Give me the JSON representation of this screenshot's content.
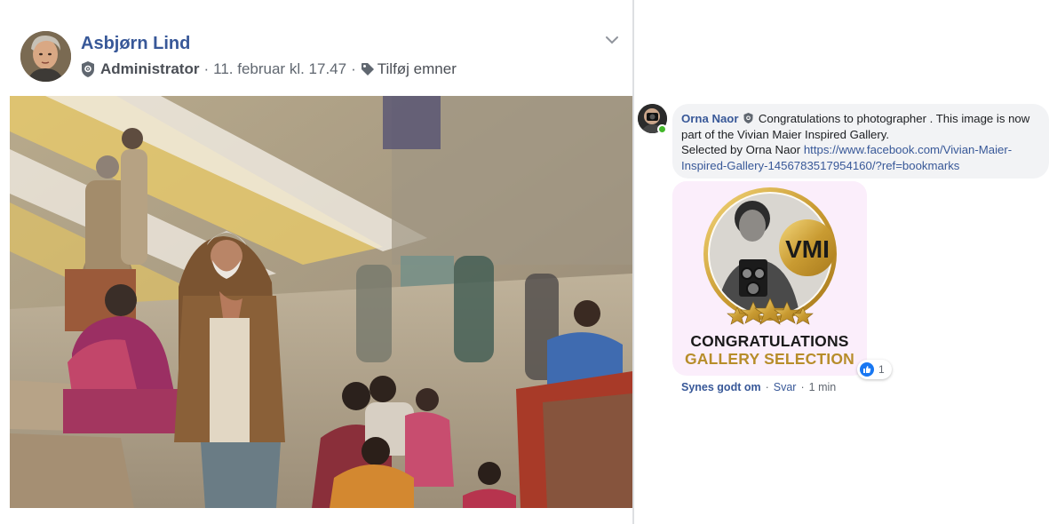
{
  "post": {
    "author": "Asbjørn Lind",
    "role": "Administrator",
    "timestamp": "11. februar kl. 17.47",
    "add_topics": "Tilføj emner",
    "separator": "·",
    "role_icon": "shield-icon",
    "topics_icon": "tag-icon",
    "menu_icon": "chevron-down-icon"
  },
  "comment": {
    "author": "Orna Naor",
    "text_main": "Congratulations to photographer . This image is now part of the Vivian Maier Inspired Gallery.",
    "selected_by": "Selected by Orna Naor",
    "link": "https://www.facebook.com/Vivian-Maier-Inspired-Gallery-1456783517954160/?ref=bookmarks",
    "sticker": {
      "badge_text": "VMI",
      "line1": "CONGRATULATIONS",
      "line2": "GALLERY SELECTION"
    },
    "reaction_count": "1",
    "like_label": "Synes godt om",
    "reply_label": "Svar",
    "time": "1 min",
    "separator": "·"
  },
  "colors": {
    "link_blue": "#385898",
    "meta_gray": "#606770",
    "bubble_bg": "#f2f3f5",
    "like_blue": "#1877f2",
    "online_green": "#42b72a",
    "gold": "#b78d2a"
  }
}
